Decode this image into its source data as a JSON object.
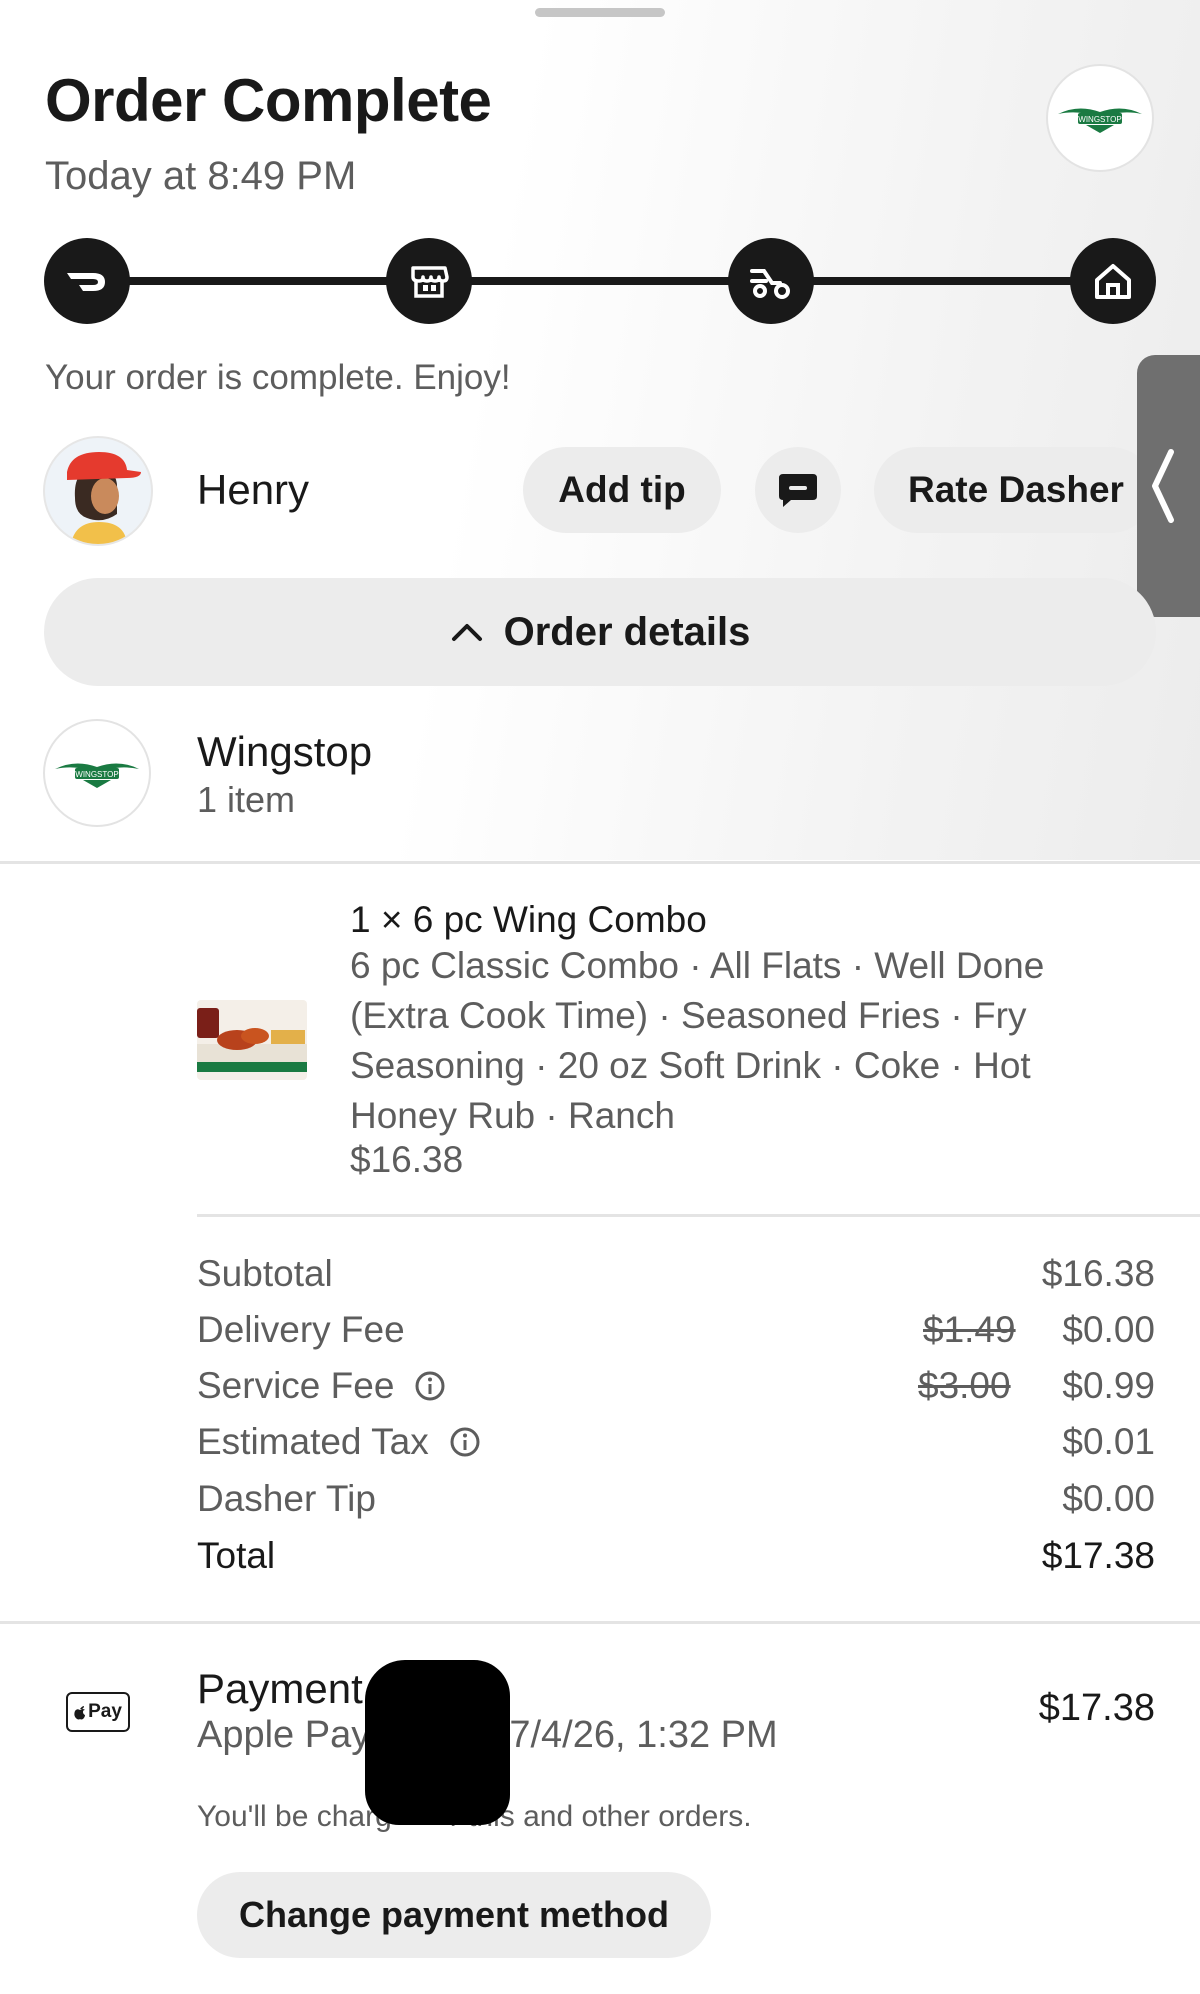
{
  "header": {
    "title": "Order Complete",
    "timestamp": "Today at 8:49 PM"
  },
  "progress": {
    "steps": [
      {
        "icon": "doordash-logo-icon"
      },
      {
        "icon": "store-icon"
      },
      {
        "icon": "dasher-scooter-icon"
      },
      {
        "icon": "home-icon"
      }
    ],
    "status_text": "Your order is complete. Enjoy!"
  },
  "dasher": {
    "name": "Henry",
    "add_tip_label": "Add tip",
    "rate_label": "Rate Dasher"
  },
  "order_details_toggle": {
    "label": "Order details",
    "icon": "chevron-up-icon"
  },
  "store": {
    "name": "Wingstop",
    "item_count": "1 item",
    "logo_text": "WINGSTOP"
  },
  "items": [
    {
      "title": "1 × 6 pc Wing Combo",
      "description": "6 pc Classic Combo · All Flats · Well Done (Extra Cook Time)  · Seasoned Fries · Fry Seasoning · 20 oz Soft Drink · Coke · Hot Honey Rub · Ranch",
      "price": "$16.38"
    }
  ],
  "summary": {
    "subtotal": {
      "label": "Subtotal",
      "value": "$16.38"
    },
    "delivery_fee": {
      "label": "Delivery Fee",
      "original": "$1.49",
      "value": "$0.00"
    },
    "service_fee": {
      "label": "Service Fee",
      "original": "$3.00",
      "value": "$0.99"
    },
    "estimated_tax": {
      "label": "Estimated Tax",
      "value": "$0.01"
    },
    "dasher_tip": {
      "label": "Dasher Tip",
      "value": "$0.00"
    },
    "total": {
      "label": "Total",
      "value": "$17.38"
    }
  },
  "payment": {
    "title": "Payment",
    "amount": "$17.38",
    "method": "Apple Pay",
    "date": "7/4/26, 1:32 PM",
    "note_prefix": "You'll be charg",
    "note_suffix": "r this and other orders.",
    "apple_pay_badge": "Pay",
    "change_label": "Change payment method"
  },
  "colors": {
    "primary_text": "#191919",
    "secondary_text": "#5d5d5d",
    "pill_bg": "#ececec",
    "wingstop_green": "#1a7a42"
  }
}
